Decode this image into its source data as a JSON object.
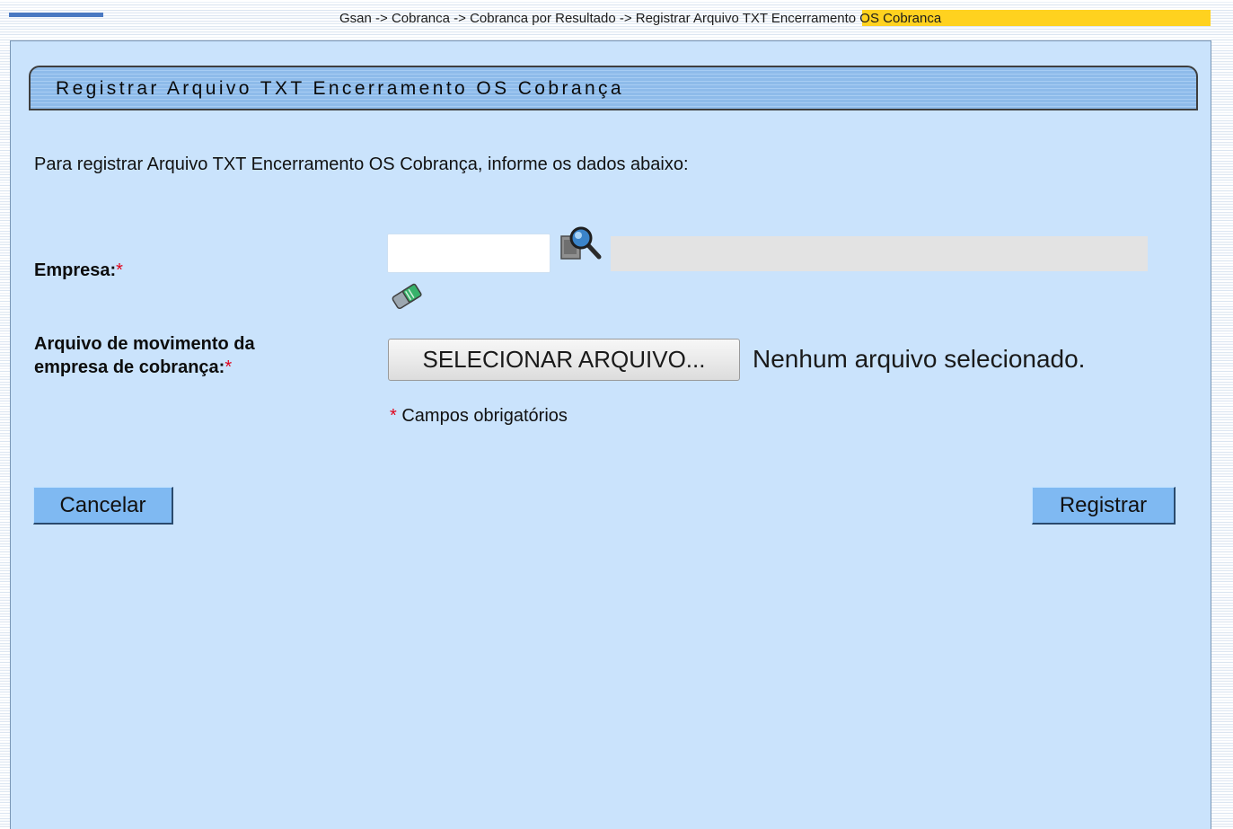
{
  "breadcrumb": "Gsan -> Cobranca -> Cobranca por Resultado -> Registrar Arquivo TXT Encerramento OS Cobranca",
  "page": {
    "title": "Registrar Arquivo TXT Encerramento OS Cobrança",
    "intro": "Para registrar Arquivo TXT Encerramento OS Cobrança, informe os dados abaixo:"
  },
  "form": {
    "empresa": {
      "label": "Empresa:",
      "required_marker": "*",
      "value": "",
      "description": "",
      "search_icon": "magnifier-search-icon",
      "clear_icon": "eraser-icon"
    },
    "arquivo": {
      "label_line1": "Arquivo de movimento da",
      "label_line2": "empresa de cobrança:",
      "required_marker": "*",
      "button_label": "SELECIONAR ARQUIVO...",
      "status": "Nenhum arquivo selecionado."
    },
    "required_note": {
      "marker": "*",
      "text": " Campos obrigatórios"
    }
  },
  "actions": {
    "cancel": "Cancelar",
    "register": "Registrar"
  },
  "colors": {
    "panel_background": "#cae3fc",
    "title_tab": "#8ebbea",
    "button": "#7fb9f2",
    "required": "#e0001a",
    "highlight": "#ffd21f"
  }
}
